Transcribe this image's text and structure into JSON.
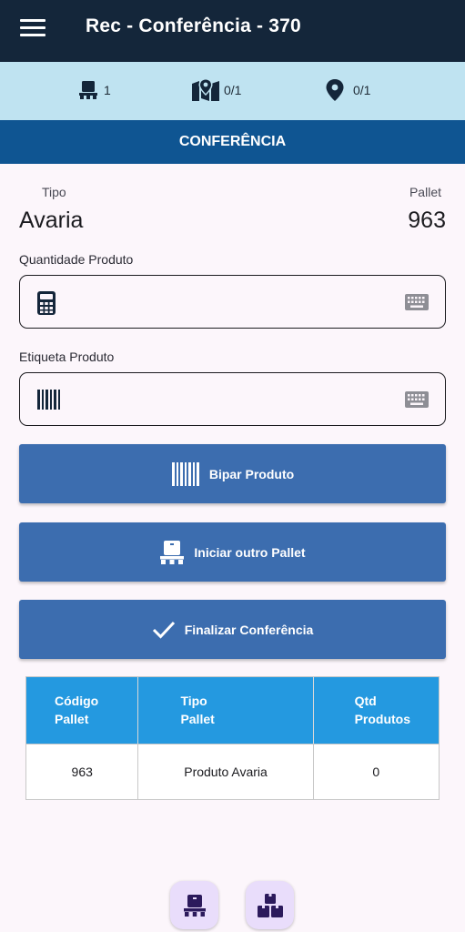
{
  "appbar": {
    "title": "Rec - Conferência - 370",
    "menu_icon": "menu-icon"
  },
  "stats": [
    {
      "icon": "pallet-icon",
      "value": "1"
    },
    {
      "icon": "map-marker-icon",
      "value": "0/1"
    },
    {
      "icon": "location-pin-icon",
      "value": "0/1"
    }
  ],
  "section": {
    "title": "CONFERÊNCIA"
  },
  "info": {
    "tipo_label": "Tipo",
    "tipo_value": "Avaria",
    "pallet_label": "Pallet",
    "pallet_value": "963"
  },
  "fields": {
    "quantidade": {
      "label": "Quantidade Produto",
      "value": "",
      "lead_icon": "calculator-icon",
      "trail_icon": "keyboard-icon"
    },
    "etiqueta": {
      "label": "Etiqueta Produto",
      "value": "",
      "lead_icon": "barcode-icon",
      "trail_icon": "keyboard-icon"
    }
  },
  "buttons": {
    "bipar": {
      "label": "Bipar Produto",
      "icon": "barcode-icon"
    },
    "iniciar": {
      "label": "Iniciar outro Pallet",
      "icon": "pallet-icon"
    },
    "finalizar": {
      "label": "Finalizar Conferência",
      "icon": "check-icon"
    }
  },
  "table": {
    "headers": [
      {
        "line1": "Código",
        "line2": "Pallet"
      },
      {
        "line1": "Tipo",
        "line2": "Pallet"
      },
      {
        "line1": "Qtd",
        "line2": "Produtos"
      }
    ],
    "rows": [
      {
        "codigo": "963",
        "tipo": "Produto Avaria",
        "qtd": "0"
      }
    ]
  },
  "bottom_actions": [
    {
      "icon": "pallet-icon"
    },
    {
      "icon": "boxes-icon"
    }
  ],
  "colors": {
    "appbar": "#14263a",
    "stats_bar": "#bfe3f1",
    "section_bar": "#0f5592",
    "button": "#3c6daf",
    "table_header": "#2499e0",
    "fab": "#e9ddfb"
  }
}
